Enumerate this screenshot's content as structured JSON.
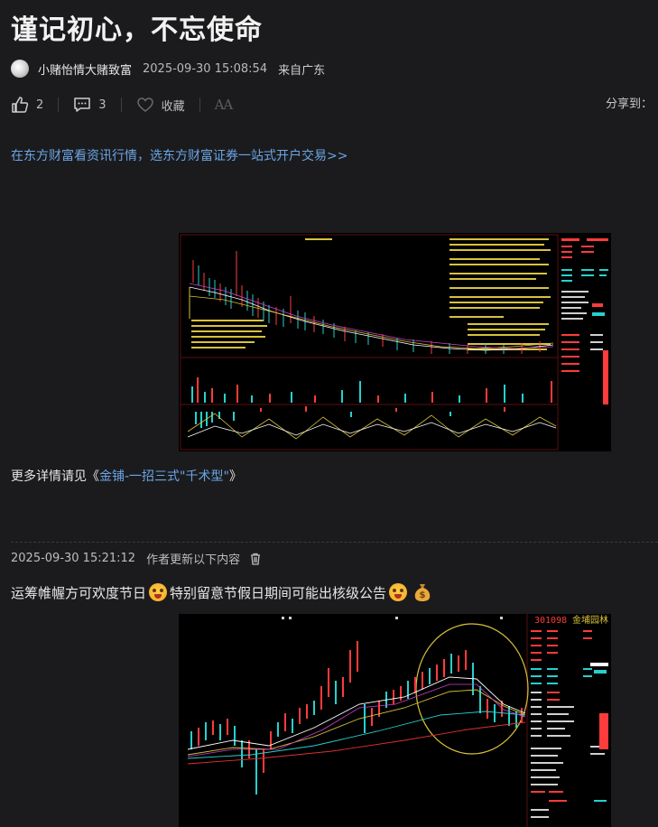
{
  "article": {
    "title": "谨记初心，不忘使命",
    "author": "小赌怡情大赌致富",
    "time": "2025-09-30 15:08:54",
    "location": "来自广东"
  },
  "actions": {
    "likes": "2",
    "comments": "3",
    "favorite_label": "收藏",
    "font_toggle": "AA",
    "share_label": "分享到："
  },
  "promo": {
    "text": "在东方财富看资讯行情，选东方财富证券一站式开户交易>>"
  },
  "more": {
    "prefix": "更多详情请见《",
    "link": "金铺-一招三式\"千术型\"",
    "suffix": "》"
  },
  "update": {
    "time": "2025-09-30 15:21:12",
    "label": "作者更新以下内容"
  },
  "post": {
    "part1": "运筹帷幄方可欢度节日",
    "part2": "特别留意节假日期间可能出核级公告"
  },
  "chart2_panel": {
    "code": "301098",
    "name": "金埔园林"
  },
  "colors": {
    "background": "#1b1b1d",
    "link": "#6aa5e6",
    "up": "#ff3b3b",
    "down": "#26d0ce"
  }
}
